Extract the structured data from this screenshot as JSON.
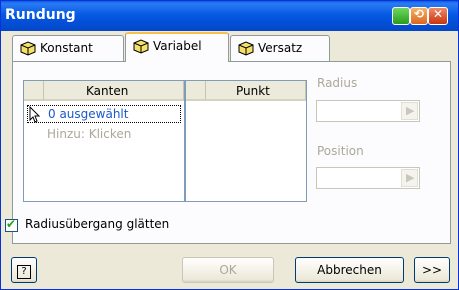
{
  "window": {
    "title": "Rundung"
  },
  "tabs": [
    {
      "label": "Konstant"
    },
    {
      "label": "Variabel"
    },
    {
      "label": "Versatz"
    }
  ],
  "list_kanten": {
    "header": "Kanten",
    "items": [
      "0 ausgewählt",
      "Hinzu: Klicken"
    ]
  },
  "list_punkt": {
    "header": "Punkt"
  },
  "fields": {
    "radius_label": "Radius",
    "position_label": "Position"
  },
  "checkbox": {
    "label": "Radiusübergang glätten",
    "checked": true
  },
  "buttons": {
    "help": "?",
    "ok": "OK",
    "cancel": "Abbrechen",
    "more": ">>"
  },
  "colors": {
    "titlebar": "#0a5be6",
    "selection_text": "#1a58c9"
  }
}
